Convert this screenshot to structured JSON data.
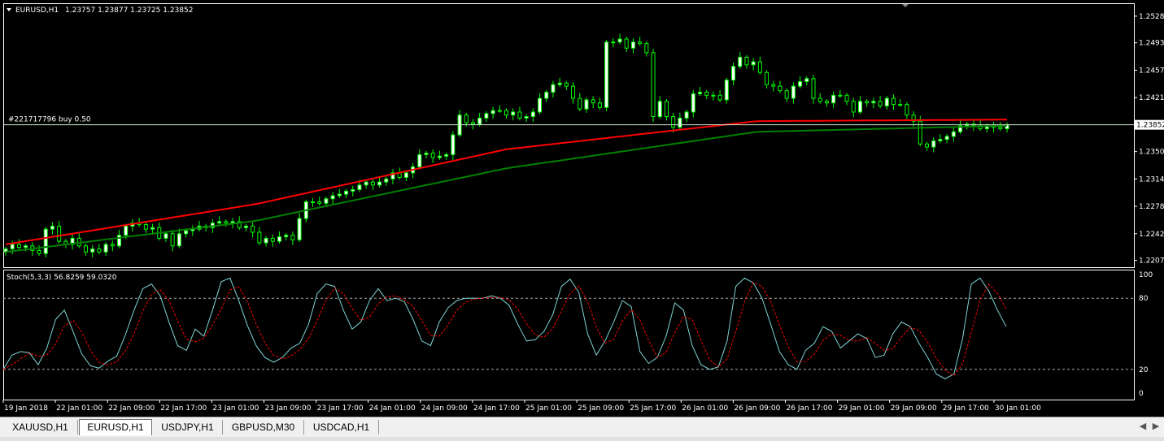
{
  "main": {
    "title": "EURUSD,H1",
    "ohlc": "1.23757 1.23877 1.23725 1.23852",
    "order_label": "#221717796 buy 0.50",
    "current_price": "1.23852",
    "price_ticks": [
      "1.25280",
      "1.24930",
      "1.24570",
      "1.24210",
      "1.23500",
      "1.23140",
      "1.22780",
      "1.22420",
      "1.22070"
    ],
    "price_min": 1.2198,
    "price_max": 1.2545
  },
  "stoch": {
    "label": "Stoch(5,3,3) 56.8259 59.0320",
    "ticks": [
      "100",
      "80",
      "20",
      "0"
    ]
  },
  "time_labels": [
    "19 Jan 2018",
    "22 Jan 01:00",
    "22 Jan 09:00",
    "22 Jan 17:00",
    "23 Jan 01:00",
    "23 Jan 09:00",
    "23 Jan 17:00",
    "24 Jan 01:00",
    "24 Jan 09:00",
    "24 Jan 17:00",
    "25 Jan 01:00",
    "25 Jan 09:00",
    "25 Jan 17:00",
    "26 Jan 01:00",
    "26 Jan 09:00",
    "26 Jan 17:00",
    "29 Jan 01:00",
    "29 Jan 09:00",
    "29 Jan 17:00",
    "30 Jan 01:00"
  ],
  "tabs": [
    "XAUUSD,H1",
    "EURUSD,H1",
    "USDJPY,H1",
    "GBPUSD,M30",
    "USDCAD,H1"
  ],
  "active_tab": "EURUSD,H1",
  "colors": {
    "background": "#000000",
    "bull": "#ffffff",
    "bear": "#000000",
    "wick": "#00ff00",
    "ma_fast": "#ff0000",
    "ma_slow": "#008000",
    "stoch_main": "#7fd4d4",
    "stoch_signal": "#ff0000",
    "grid": "#ffffff"
  },
  "chart_data": {
    "type": "candlestick",
    "close": [
      1.2222,
      1.2228,
      1.2224,
      1.2226,
      1.222,
      1.2216,
      1.2248,
      1.2252,
      1.2232,
      1.2228,
      1.2236,
      1.2226,
      1.2218,
      1.2222,
      1.2218,
      1.2228,
      1.2226,
      1.224,
      1.2252,
      1.2256,
      1.2254,
      1.2248,
      1.225,
      1.2236,
      1.2242,
      1.2226,
      1.2242,
      1.2246,
      1.2248,
      1.2252,
      1.225,
      1.2256,
      1.2258,
      1.2256,
      1.2258,
      1.225,
      1.2252,
      1.2244,
      1.223,
      1.2236,
      1.2232,
      1.2238,
      1.224,
      1.2234,
      1.2262,
      1.2284,
      1.2284,
      1.2282,
      1.2288,
      1.2292,
      1.2294,
      1.2298,
      1.23,
      1.2306,
      1.231,
      1.2306,
      1.231,
      1.2314,
      1.2322,
      1.2316,
      1.2322,
      1.233,
      1.2346,
      1.2348,
      1.2342,
      1.2344,
      1.2346,
      1.2372,
      1.2398,
      1.2388,
      1.2386,
      1.2394,
      1.24,
      1.2404,
      1.2404,
      1.2398,
      1.2402,
      1.2394,
      1.2396,
      1.2402,
      1.242,
      1.2428,
      1.2438,
      1.244,
      1.2436,
      1.242,
      1.2406,
      1.2418,
      1.2414,
      1.2408,
      1.2494,
      1.2494,
      1.2498,
      1.2486,
      1.2494,
      1.2492,
      1.248,
      1.2396,
      1.2416,
      1.2396,
      1.2382,
      1.2394,
      1.2402,
      1.2426,
      1.2428,
      1.2424,
      1.2424,
      1.2418,
      1.2444,
      1.2462,
      1.2474,
      1.2464,
      1.2468,
      1.2454,
      1.2438,
      1.2436,
      1.243,
      1.242,
      1.2436,
      1.2442,
      1.2446,
      1.242,
      1.2416,
      1.2414,
      1.2424,
      1.2424,
      1.2416,
      1.2402,
      1.2416,
      1.2414,
      1.2416,
      1.241,
      1.242,
      1.2412,
      1.2412,
      1.2398,
      1.239,
      1.236,
      1.2356,
      1.2364,
      1.2366,
      1.237,
      1.2376,
      1.2384,
      1.2386,
      1.2384,
      1.238,
      1.2384,
      1.2382,
      1.238,
      1.2385
    ],
    "ma_fast": [
      1.2228,
      1.2281,
      1.2353,
      1.239,
      1.2392
    ],
    "ma_slow": [
      1.2218,
      1.2259,
      1.2328,
      1.2376,
      1.2384
    ],
    "stoch_k": [
      20,
      32,
      35,
      34,
      24,
      38,
      62,
      70,
      52,
      33,
      23,
      21,
      27,
      31,
      49,
      70,
      88,
      92,
      82,
      60,
      40,
      36,
      54,
      48,
      70,
      94,
      97,
      78,
      57,
      40,
      30,
      26,
      30,
      38,
      42,
      58,
      84,
      92,
      90,
      70,
      54,
      60,
      78,
      88,
      78,
      80,
      77,
      62,
      44,
      40,
      60,
      72,
      78,
      80,
      80,
      80,
      82,
      80,
      74,
      58,
      44,
      45,
      52,
      66,
      90,
      96,
      85,
      50,
      32,
      44,
      60,
      78,
      73,
      35,
      25,
      30,
      48,
      76,
      70,
      40,
      24,
      20,
      22,
      44,
      90,
      97,
      93,
      80,
      58,
      35,
      24,
      20,
      36,
      42,
      56,
      52,
      38,
      44,
      50,
      46,
      30,
      32,
      50,
      60,
      56,
      42,
      30,
      16,
      12,
      16,
      46,
      92,
      97,
      86,
      70,
      56
    ]
  }
}
